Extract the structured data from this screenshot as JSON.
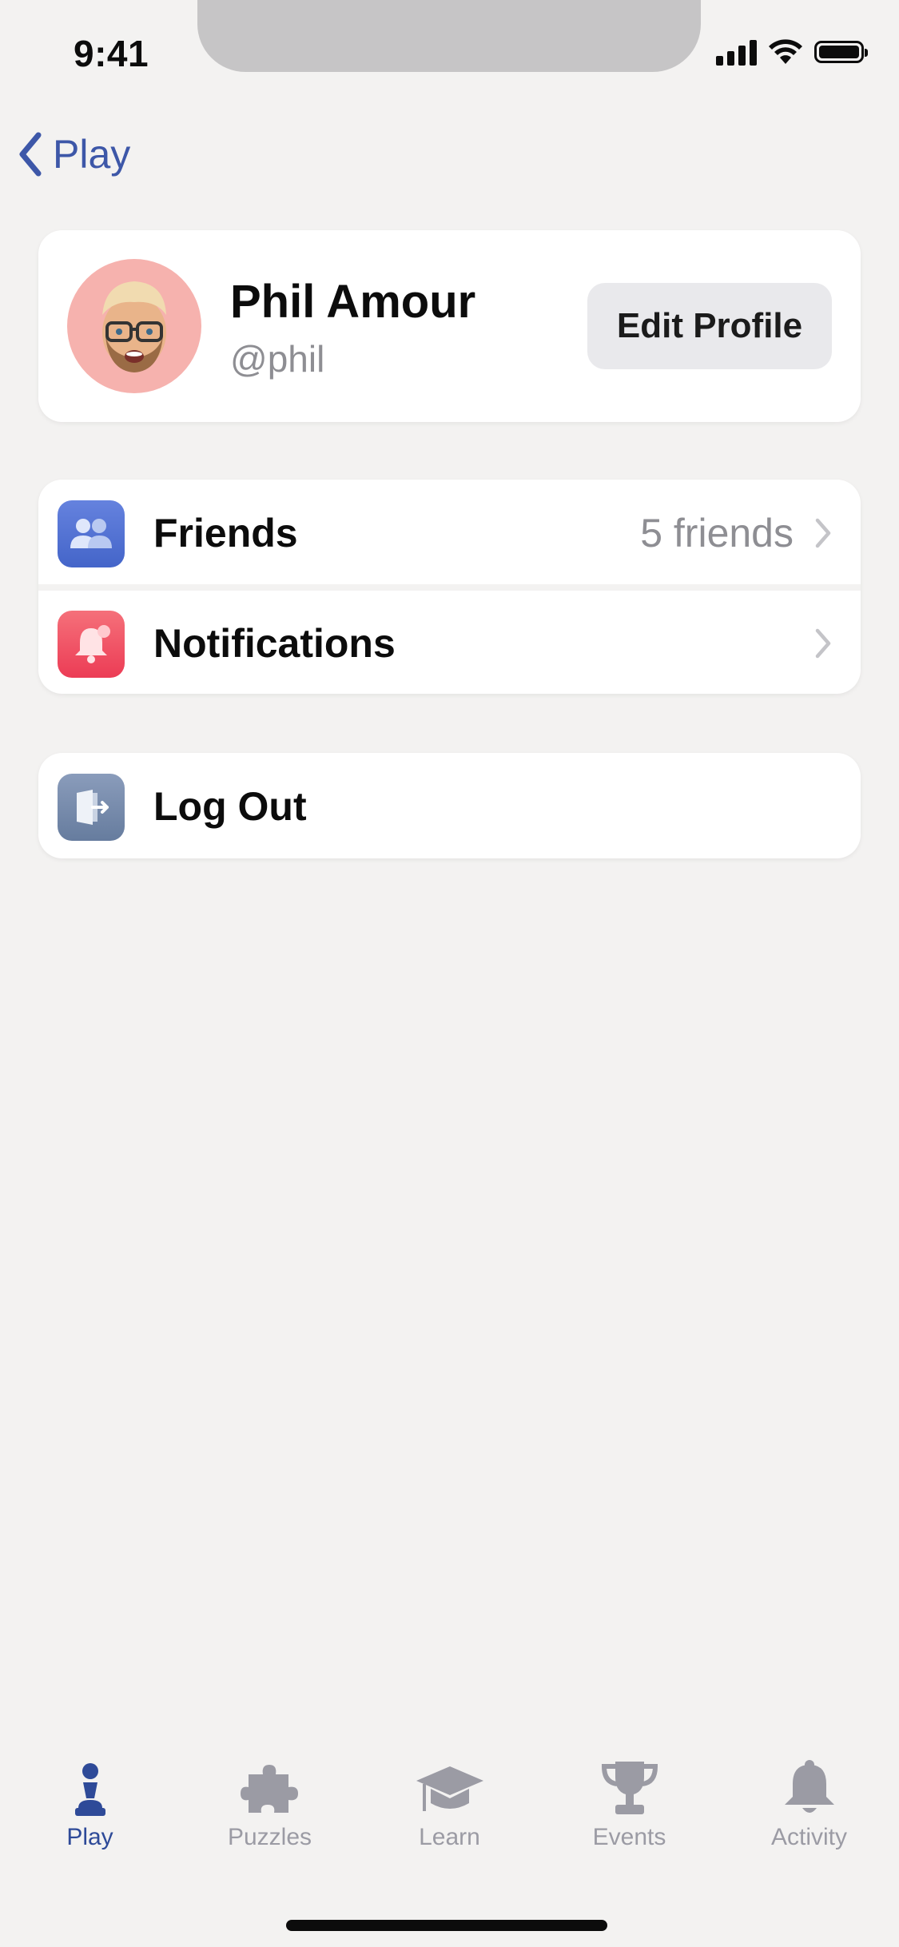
{
  "status_bar": {
    "time": "9:41"
  },
  "nav": {
    "back_label": "Play"
  },
  "profile": {
    "name": "Phil Amour",
    "handle": "@phil",
    "edit_button": "Edit Profile",
    "avatar_bg": "#f6b2ae"
  },
  "menu": {
    "friends": {
      "label": "Friends",
      "value": "5 friends",
      "icon": "friends-icon",
      "color": "#4c6fd1"
    },
    "notifications": {
      "label": "Notifications",
      "icon": "bell-icon",
      "color": "#f0465a"
    },
    "logout": {
      "label": "Log Out",
      "icon": "logout-door-icon",
      "color": "#7287a8"
    }
  },
  "tabbar": {
    "active": "Play",
    "accent": "#2e4a98",
    "inactive": "#9b9ba4",
    "tabs": [
      {
        "label": "Play",
        "icon": "pawn-icon"
      },
      {
        "label": "Puzzles",
        "icon": "puzzle-icon"
      },
      {
        "label": "Learn",
        "icon": "graduation-cap-icon"
      },
      {
        "label": "Events",
        "icon": "trophy-icon"
      },
      {
        "label": "Activity",
        "icon": "bell-icon"
      }
    ]
  }
}
